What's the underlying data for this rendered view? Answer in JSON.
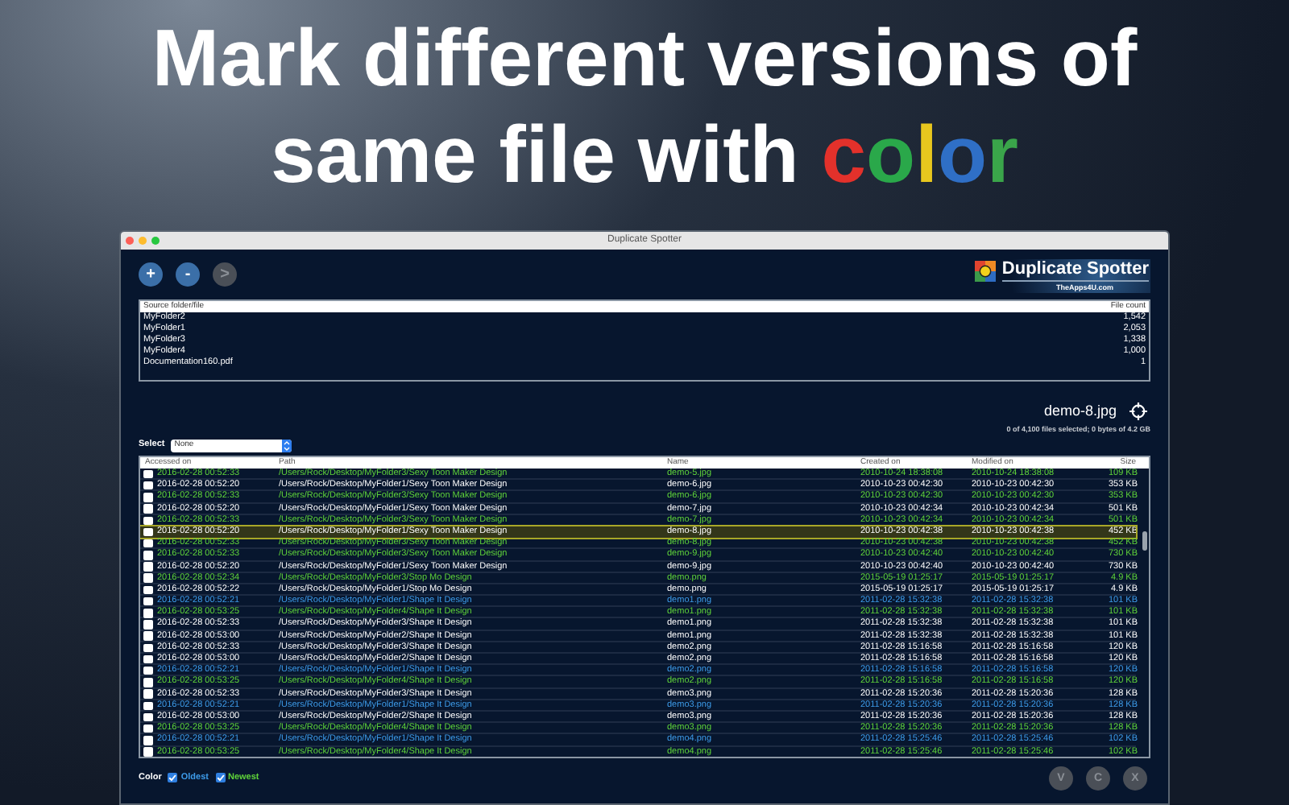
{
  "headline": {
    "line_1": "Mark different versions of",
    "line_2": "same file with ",
    "highlight": [
      {
        "text": "c",
        "color": "#e3312b"
      },
      {
        "text": "o",
        "color": "#2aa84a"
      },
      {
        "text": "l",
        "color": "#e8c71e"
      },
      {
        "text": "o",
        "color": "#2f6fc6"
      },
      {
        "text": "r",
        "color": "#3aa54a"
      }
    ]
  },
  "window": {
    "title": "Duplicate Spotter"
  },
  "toolbar": {
    "buttons": [
      {
        "label": "+",
        "disabled": false
      },
      {
        "label": "-",
        "disabled": false
      },
      {
        "label": ">",
        "disabled": true
      }
    ]
  },
  "logo": {
    "name": "Duplicate Spotter",
    "site": "TheApps4U.com"
  },
  "sources": {
    "columns": [
      "Source folder/file",
      "File count"
    ],
    "rows": [
      [
        "MyFolder2",
        "1,542"
      ],
      [
        "MyFolder1",
        "2,053"
      ],
      [
        "MyFolder3",
        "1,338"
      ],
      [
        "MyFolder4",
        "1,000"
      ],
      [
        "Documentation160.pdf",
        "1"
      ]
    ]
  },
  "preview": {
    "file": "demo-8.jpg",
    "summary": "0 of 4,100 files selected; 0 bytes of 4.2 GB"
  },
  "select": {
    "label": "Select",
    "value": "None"
  },
  "files": {
    "columns": [
      "Accessed on",
      "Path",
      "Name",
      "Created on",
      "Modified on",
      "Size"
    ],
    "rows": [
      {
        "color": "#5fd33a",
        "selected": false,
        "checked": false,
        "cells": [
          "2016-02-28 00:52:33",
          "/Users/Rock/Desktop/MyFolder3/Sexy Toon Maker Design",
          "demo-5.jpg",
          "2010-10-24 18:38:08",
          "2010-10-24 18:38:08",
          "109 KB"
        ]
      },
      {
        "color": "#ffffff",
        "selected": false,
        "checked": false,
        "cells": [
          "2016-02-28 00:52:20",
          "/Users/Rock/Desktop/MyFolder1/Sexy Toon Maker Design",
          "demo-6.jpg",
          "2010-10-23 00:42:30",
          "2010-10-23 00:42:30",
          "353 KB"
        ]
      },
      {
        "color": "#5fd33a",
        "selected": false,
        "checked": false,
        "cells": [
          "2016-02-28 00:52:33",
          "/Users/Rock/Desktop/MyFolder3/Sexy Toon Maker Design",
          "demo-6.jpg",
          "2010-10-23 00:42:30",
          "2010-10-23 00:42:30",
          "353 KB"
        ]
      },
      {
        "color": "#ffffff",
        "selected": false,
        "checked": false,
        "cells": [
          "2016-02-28 00:52:20",
          "/Users/Rock/Desktop/MyFolder1/Sexy Toon Maker Design",
          "demo-7.jpg",
          "2010-10-23 00:42:34",
          "2010-10-23 00:42:34",
          "501 KB"
        ]
      },
      {
        "color": "#5fd33a",
        "selected": false,
        "checked": false,
        "cells": [
          "2016-02-28 00:52:33",
          "/Users/Rock/Desktop/MyFolder3/Sexy Toon Maker Design",
          "demo-7.jpg",
          "2010-10-23 00:42:34",
          "2010-10-23 00:42:34",
          "501 KB"
        ]
      },
      {
        "color": "#ffffff",
        "selected": true,
        "checked": false,
        "cells": [
          "2016-02-28 00:52:20",
          "/Users/Rock/Desktop/MyFolder1/Sexy Toon Maker Design",
          "demo-8.jpg",
          "2010-10-23 00:42:38",
          "2010-10-23 00:42:38",
          "452 KB"
        ]
      },
      {
        "color": "#5fd33a",
        "selected": false,
        "checked": false,
        "cells": [
          "2016-02-28 00:52:33",
          "/Users/Rock/Desktop/MyFolder3/Sexy Toon Maker Design",
          "demo-8.jpg",
          "2010-10-23 00:42:38",
          "2010-10-23 00:42:38",
          "452 KB"
        ]
      },
      {
        "color": "#5fd33a",
        "selected": false,
        "checked": false,
        "cells": [
          "2016-02-28 00:52:33",
          "/Users/Rock/Desktop/MyFolder3/Sexy Toon Maker Design",
          "demo-9.jpg",
          "2010-10-23 00:42:40",
          "2010-10-23 00:42:40",
          "730 KB"
        ]
      },
      {
        "color": "#ffffff",
        "selected": false,
        "checked": false,
        "cells": [
          "2016-02-28 00:52:20",
          "/Users/Rock/Desktop/MyFolder1/Sexy Toon Maker Design",
          "demo-9.jpg",
          "2010-10-23 00:42:40",
          "2010-10-23 00:42:40",
          "730 KB"
        ]
      },
      {
        "color": "#5fd33a",
        "selected": false,
        "checked": false,
        "cells": [
          "2016-02-28 00:52:34",
          "/Users/Rock/Desktop/MyFolder3/Stop Mo Design",
          "demo.png",
          "2015-05-19 01:25:17",
          "2015-05-19 01:25:17",
          "4.9 KB"
        ]
      },
      {
        "color": "#ffffff",
        "selected": false,
        "checked": false,
        "cells": [
          "2016-02-28 00:52:22",
          "/Users/Rock/Desktop/MyFolder1/Stop Mo Design",
          "demo.png",
          "2015-05-19 01:25:17",
          "2015-05-19 01:25:17",
          "4.9 KB"
        ]
      },
      {
        "color": "#3d9be9",
        "selected": false,
        "checked": false,
        "cells": [
          "2016-02-28 00:52:21",
          "/Users/Rock/Desktop/MyFolder1/Shape It Design",
          "demo1.png",
          "2011-02-28 15:32:38",
          "2011-02-28 15:32:38",
          "101 KB"
        ]
      },
      {
        "color": "#5fd33a",
        "selected": false,
        "checked": false,
        "cells": [
          "2016-02-28 00:53:25",
          "/Users/Rock/Desktop/MyFolder4/Shape It Design",
          "demo1.png",
          "2011-02-28 15:32:38",
          "2011-02-28 15:32:38",
          "101 KB"
        ]
      },
      {
        "color": "#ffffff",
        "selected": false,
        "checked": false,
        "cells": [
          "2016-02-28 00:52:33",
          "/Users/Rock/Desktop/MyFolder3/Shape It Design",
          "demo1.png",
          "2011-02-28 15:32:38",
          "2011-02-28 15:32:38",
          "101 KB"
        ]
      },
      {
        "color": "#ffffff",
        "selected": false,
        "checked": false,
        "cells": [
          "2016-02-28 00:53:00",
          "/Users/Rock/Desktop/MyFolder2/Shape It Design",
          "demo1.png",
          "2011-02-28 15:32:38",
          "2011-02-28 15:32:38",
          "101 KB"
        ]
      },
      {
        "color": "#ffffff",
        "selected": false,
        "checked": false,
        "cells": [
          "2016-02-28 00:52:33",
          "/Users/Rock/Desktop/MyFolder3/Shape It Design",
          "demo2.png",
          "2011-02-28 15:16:58",
          "2011-02-28 15:16:58",
          "120 KB"
        ]
      },
      {
        "color": "#ffffff",
        "selected": false,
        "checked": false,
        "cells": [
          "2016-02-28 00:53:00",
          "/Users/Rock/Desktop/MyFolder2/Shape It Design",
          "demo2.png",
          "2011-02-28 15:16:58",
          "2011-02-28 15:16:58",
          "120 KB"
        ]
      },
      {
        "color": "#3d9be9",
        "selected": false,
        "checked": false,
        "cells": [
          "2016-02-28 00:52:21",
          "/Users/Rock/Desktop/MyFolder1/Shape It Design",
          "demo2.png",
          "2011-02-28 15:16:58",
          "2011-02-28 15:16:58",
          "120 KB"
        ]
      },
      {
        "color": "#5fd33a",
        "selected": false,
        "checked": false,
        "cells": [
          "2016-02-28 00:53:25",
          "/Users/Rock/Desktop/MyFolder4/Shape It Design",
          "demo2.png",
          "2011-02-28 15:16:58",
          "2011-02-28 15:16:58",
          "120 KB"
        ]
      },
      {
        "color": "#ffffff",
        "selected": false,
        "checked": false,
        "cells": [
          "2016-02-28 00:52:33",
          "/Users/Rock/Desktop/MyFolder3/Shape It Design",
          "demo3.png",
          "2011-02-28 15:20:36",
          "2011-02-28 15:20:36",
          "128 KB"
        ]
      },
      {
        "color": "#3d9be9",
        "selected": false,
        "checked": false,
        "cells": [
          "2016-02-28 00:52:21",
          "/Users/Rock/Desktop/MyFolder1/Shape It Design",
          "demo3.png",
          "2011-02-28 15:20:36",
          "2011-02-28 15:20:36",
          "128 KB"
        ]
      },
      {
        "color": "#ffffff",
        "selected": false,
        "checked": false,
        "cells": [
          "2016-02-28 00:53:00",
          "/Users/Rock/Desktop/MyFolder2/Shape It Design",
          "demo3.png",
          "2011-02-28 15:20:36",
          "2011-02-28 15:20:36",
          "128 KB"
        ]
      },
      {
        "color": "#5fd33a",
        "selected": false,
        "checked": false,
        "cells": [
          "2016-02-28 00:53:25",
          "/Users/Rock/Desktop/MyFolder4/Shape It Design",
          "demo3.png",
          "2011-02-28 15:20:36",
          "2011-02-28 15:20:36",
          "128 KB"
        ]
      },
      {
        "color": "#3d9be9",
        "selected": false,
        "checked": false,
        "cells": [
          "2016-02-28 00:52:21",
          "/Users/Rock/Desktop/MyFolder1/Shape It Design",
          "demo4.png",
          "2011-02-28 15:25:46",
          "2011-02-28 15:25:46",
          "102 KB"
        ]
      },
      {
        "color": "#5fd33a",
        "selected": false,
        "checked": false,
        "cells": [
          "2016-02-28 00:53:25",
          "/Users/Rock/Desktop/MyFolder4/Shape It Design",
          "demo4.png",
          "2011-02-28 15:25:46",
          "2011-02-28 15:25:46",
          "102 KB"
        ]
      }
    ]
  },
  "color_options": {
    "label": "Color",
    "options": [
      {
        "label": "Oldest",
        "checked": true,
        "color": "#3d9be9"
      },
      {
        "label": "Newest",
        "checked": true,
        "color": "#5fd33a"
      }
    ]
  },
  "actions": [
    {
      "label": "V",
      "disabled": true
    },
    {
      "label": "C",
      "disabled": true
    },
    {
      "label": "X",
      "disabled": true
    }
  ]
}
